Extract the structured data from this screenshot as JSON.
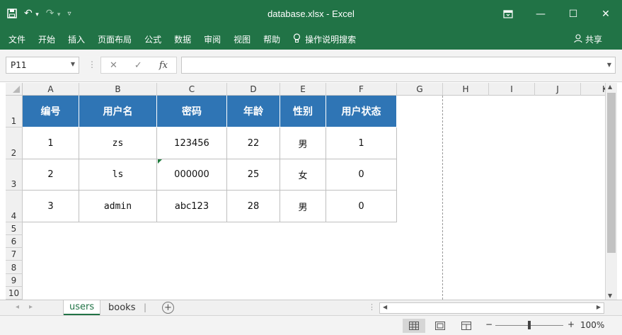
{
  "window": {
    "title": "database.xlsx  -  Excel",
    "quick_access": {
      "save_icon": "save-icon",
      "undo_icon": "undo-icon",
      "redo_icon": "redo-icon",
      "customize_icon": "customize-qat-icon"
    },
    "controls": {
      "restore_ribbon_icon": "ribbon-display-icon",
      "minimize": "—",
      "maximize": "☐",
      "close": "✕"
    }
  },
  "ribbon": {
    "tabs": [
      "文件",
      "开始",
      "插入",
      "页面布局",
      "公式",
      "数据",
      "审阅",
      "视图",
      "帮助"
    ],
    "tell_me": "操作说明搜索",
    "share": "共享"
  },
  "formula_bar": {
    "name_box": "P11",
    "cancel_icon": "✕",
    "enter_icon": "✓",
    "fx_label": "fx",
    "formula": ""
  },
  "sheet": {
    "columns": [
      "A",
      "B",
      "C",
      "D",
      "E",
      "F",
      "G",
      "H",
      "I",
      "J",
      "K"
    ],
    "rows": [
      "1",
      "2",
      "3",
      "4",
      "5",
      "6",
      "7",
      "8",
      "9",
      "10"
    ],
    "header_fill": "#2f75b5",
    "table": {
      "headers": [
        "编号",
        "用户名",
        "密码",
        "年龄",
        "性别",
        "用户状态"
      ],
      "rows": [
        [
          "1",
          "zs",
          "123456",
          "22",
          "男",
          "1"
        ],
        [
          "2",
          "ls",
          "000000",
          "25",
          "女",
          "0"
        ],
        [
          "3",
          "admin",
          "abc123",
          "28",
          "男",
          "0"
        ]
      ]
    }
  },
  "sheet_tabs": {
    "tabs": [
      "users",
      "books"
    ],
    "active": "users",
    "add_sheet": "+"
  },
  "status_bar": {
    "zoom_out": "−",
    "zoom_in": "+",
    "zoom": "100%"
  },
  "colors": {
    "accent": "#217346",
    "header_fill": "#2f75b5"
  }
}
